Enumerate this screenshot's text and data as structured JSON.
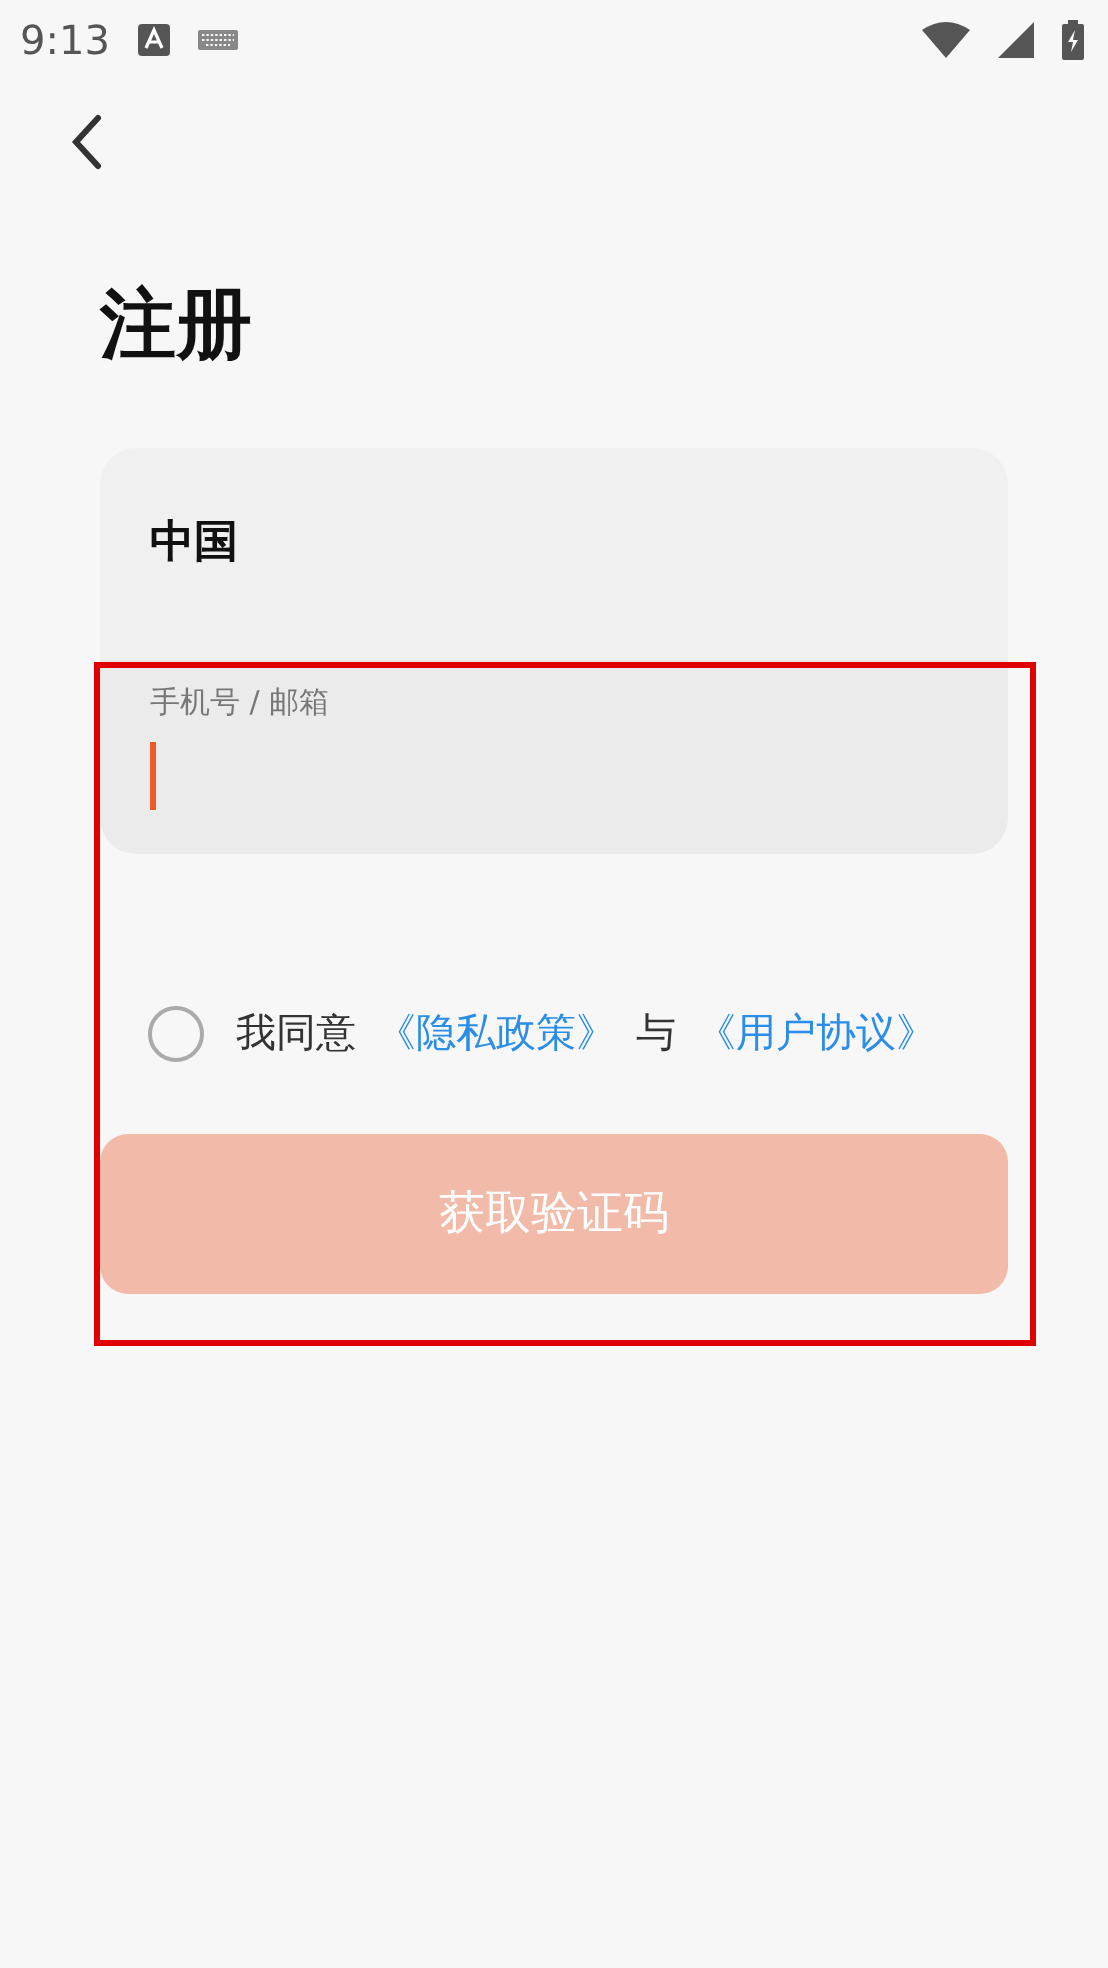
{
  "status_bar": {
    "time": "9:13"
  },
  "title": "注册",
  "country": {
    "value": "中国"
  },
  "account_field": {
    "label": "手机号 / 邮箱",
    "focused": true
  },
  "agreement": {
    "checked": false,
    "parts": [
      {
        "kind": "text",
        "text": "我同意"
      },
      {
        "kind": "link",
        "text": "《隐私政策》"
      },
      {
        "kind": "text",
        "text": "与"
      },
      {
        "kind": "link",
        "text": "《用户协议》"
      }
    ]
  },
  "submit_button": {
    "label": "获取验证码",
    "disabled": true
  }
}
